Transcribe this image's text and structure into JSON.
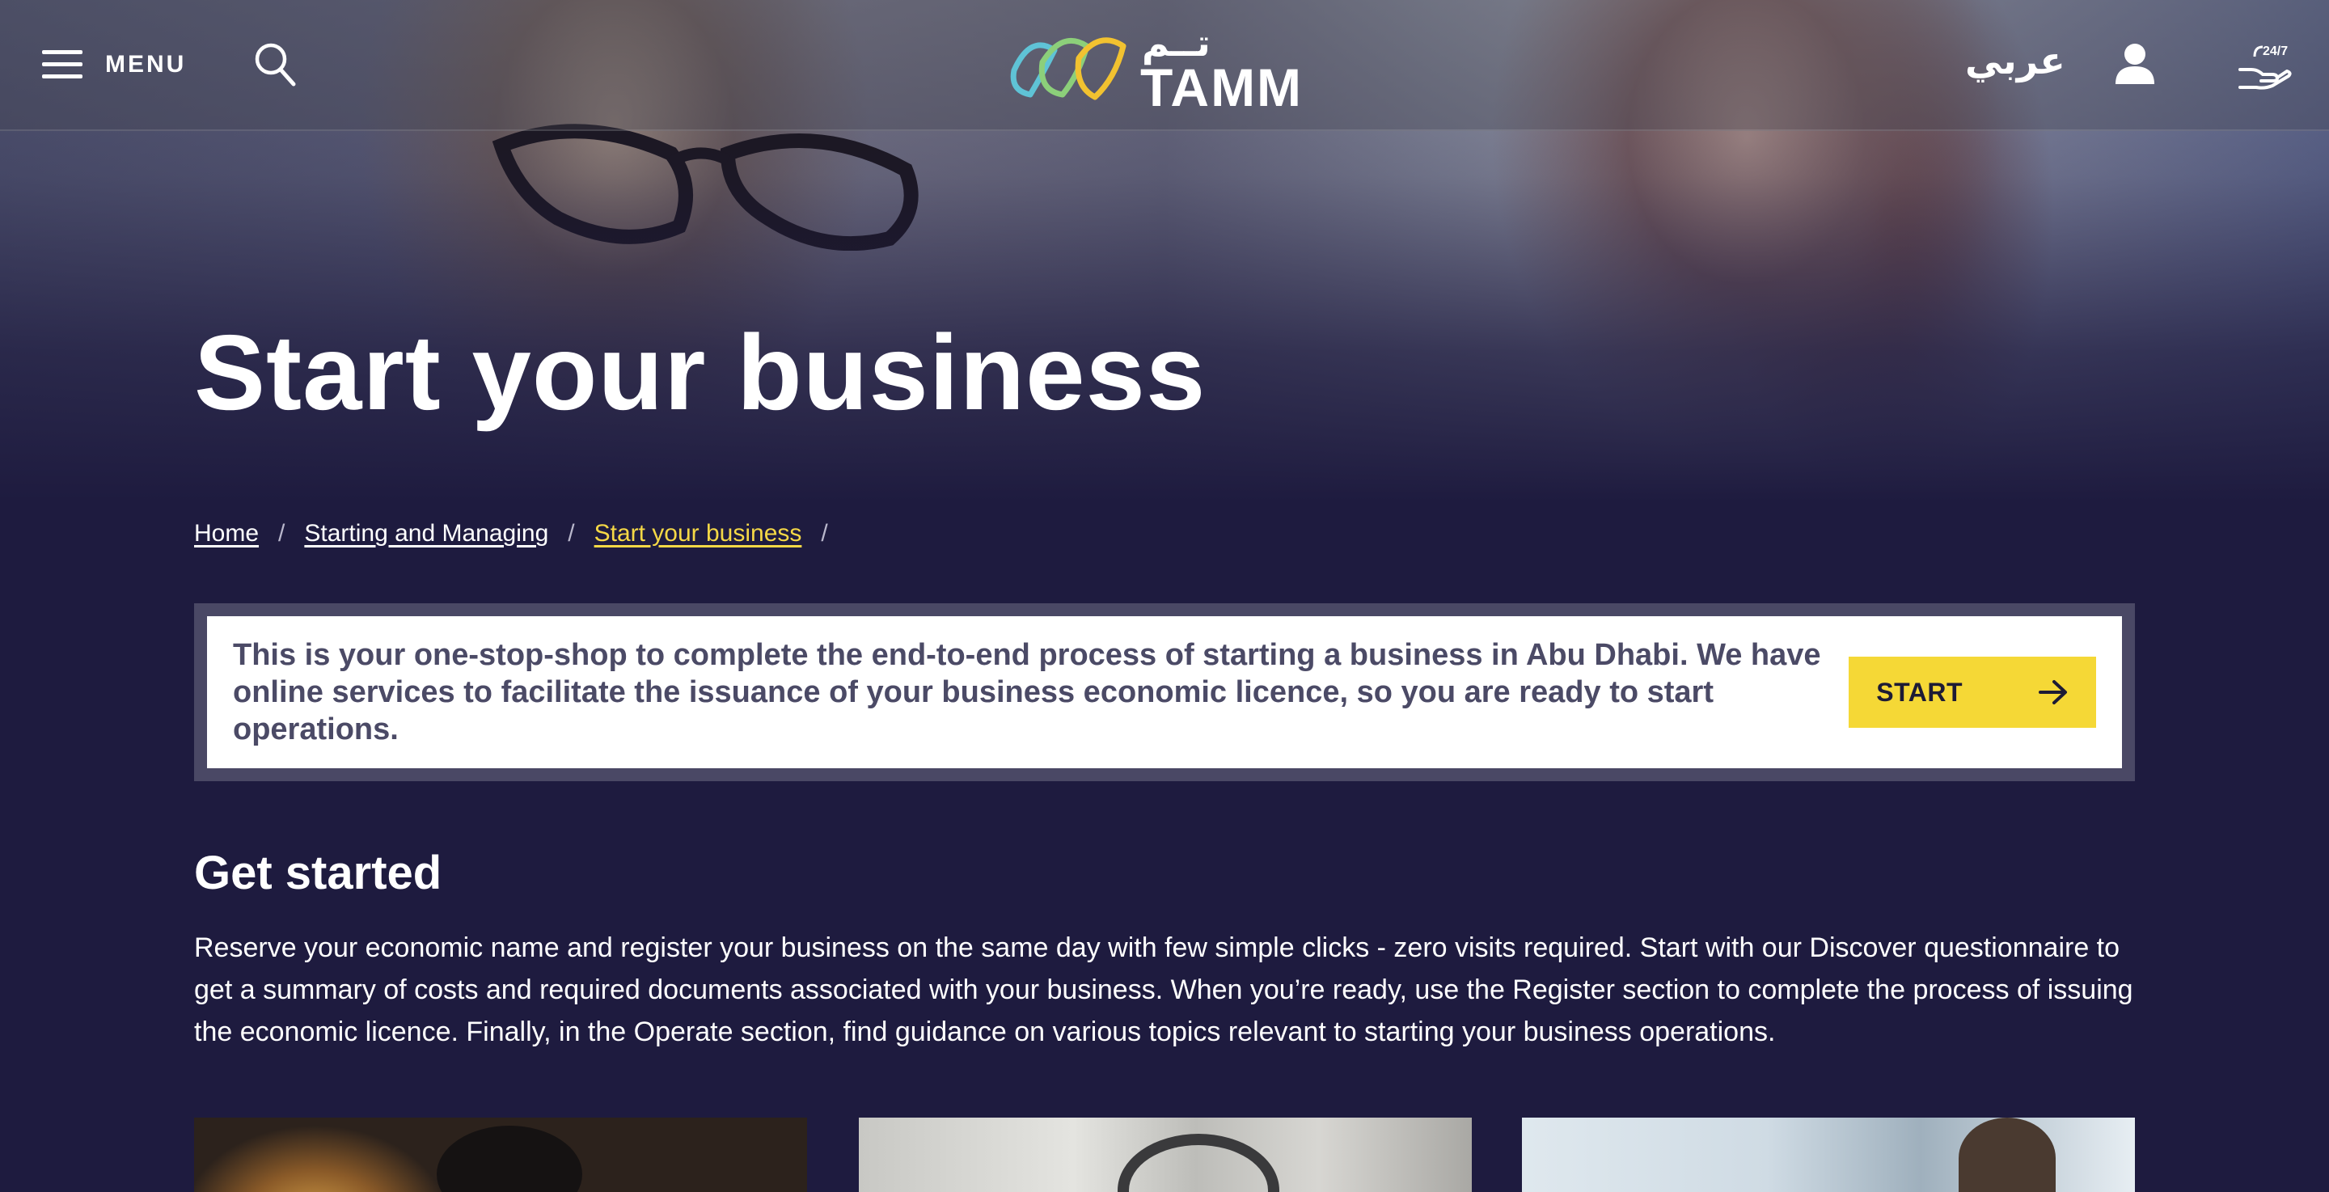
{
  "nav": {
    "menu_label": "MENU",
    "logo_text": "TAMM",
    "logo_arabic": "تــم",
    "language_label": "عربي",
    "icons": [
      "hamburger-icon",
      "search-icon",
      "user-icon",
      "support-24-7-icon"
    ]
  },
  "hero": {
    "title": "Start your business"
  },
  "breadcrumb": {
    "items": [
      "Home",
      "Starting and Managing",
      "Start your business"
    ],
    "separator": "/"
  },
  "info": {
    "text": "This is your one-stop-shop to complete the end-to-end process of starting a business in Abu Dhabi. We have online services to facilitate the issuance of your business economic licence, so you are ready to start operations.",
    "start_label": "START"
  },
  "get_started": {
    "title": "Get started",
    "body": "Reserve your economic name and register your business on the same day with few simple clicks - zero visits required. Start with our Discover questionnaire to get a summary of costs and required documents associated with your business. When you’re ready, use the Register section to complete the process of issuing the economic licence. Finally, in the Operate section, find guidance on various topics relevant to starting your business operations."
  },
  "colors": {
    "background": "#1e1b3f",
    "accent_yellow": "#f5d836",
    "breadcrumb_current": "#f5d846",
    "info_text": "#4b4a66"
  }
}
